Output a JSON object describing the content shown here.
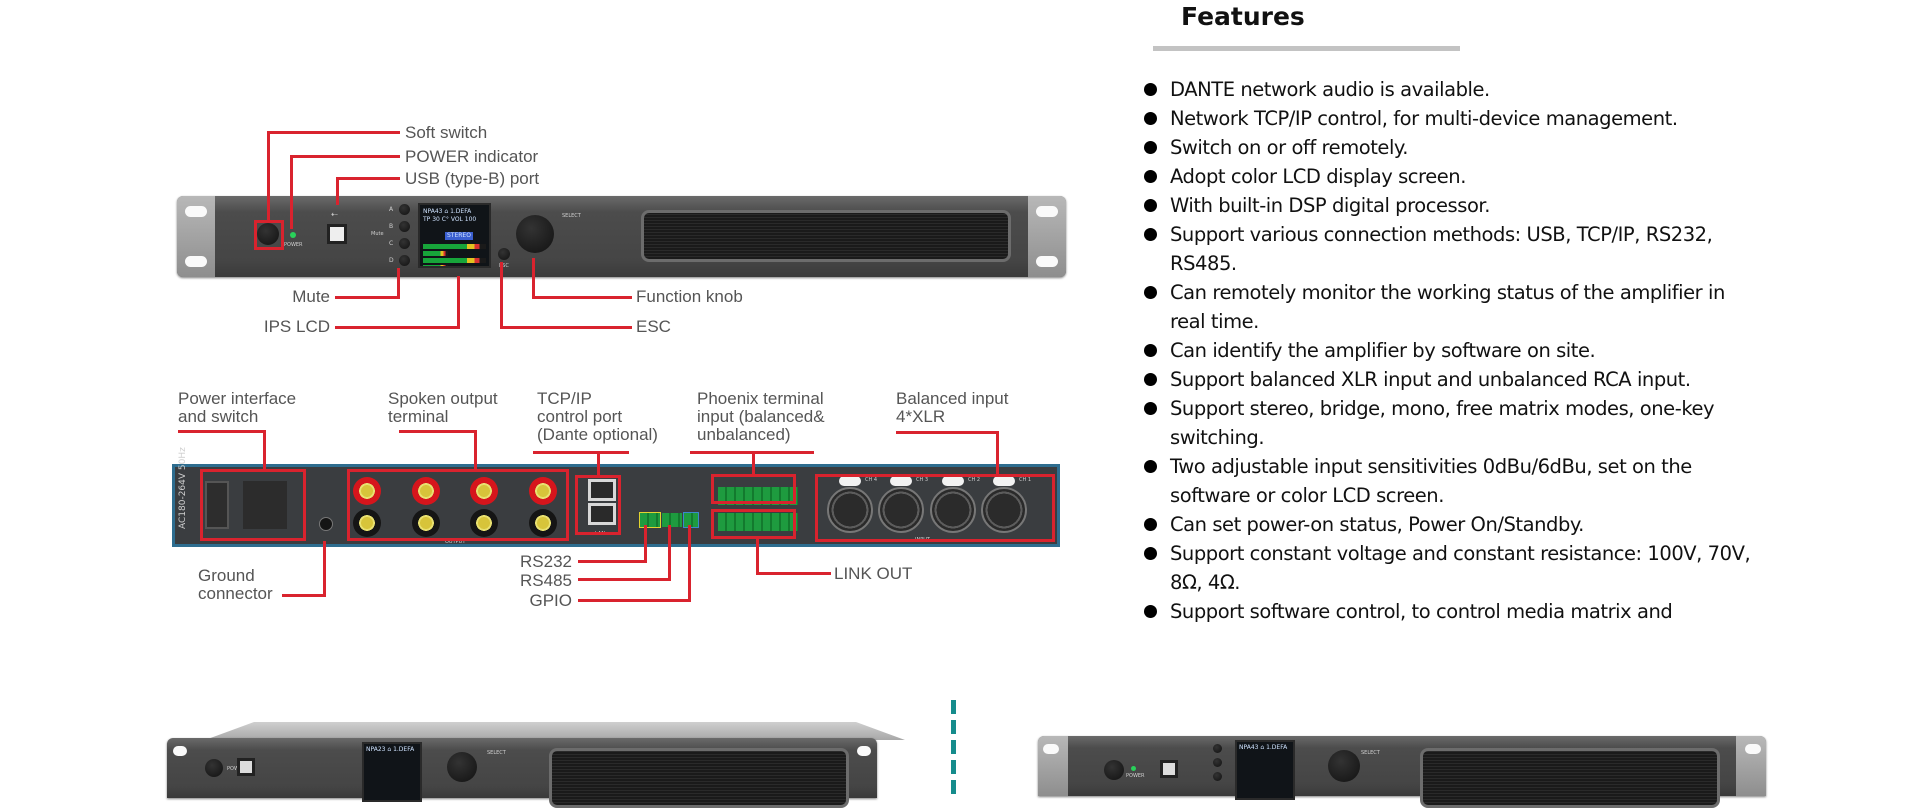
{
  "features": {
    "title": "Features",
    "items": [
      {
        "lines": [
          "DANTE network audio is available."
        ]
      },
      {
        "lines": [
          "Network TCP/IP control, for multi-device management."
        ]
      },
      {
        "lines": [
          "Switch on or off remotely."
        ]
      },
      {
        "lines": [
          "Adopt color LCD display screen."
        ]
      },
      {
        "lines": [
          "With built-in DSP digital processor."
        ]
      },
      {
        "lines": [
          "Support various connection methods: USB, TCP/IP, RS232,",
          "RS485."
        ]
      },
      {
        "lines": [
          "Can remotely monitor the working status of the amplifier in",
          "real time."
        ]
      },
      {
        "lines": [
          "Can identify the amplifier by software on site."
        ]
      },
      {
        "lines": [
          "Support balanced XLR input and unbalanced RCA input."
        ]
      },
      {
        "lines": [
          "Support stereo, bridge, mono, free matrix modes, one-key",
          "switching."
        ]
      },
      {
        "lines": [
          "Two adjustable input sensitivities 0dBu/6dBu, set on the",
          "software or color LCD screen."
        ]
      },
      {
        "lines": [
          "Can set power-on status, Power On/Standby."
        ]
      },
      {
        "lines": [
          "Support constant voltage and constant resistance: 100V, 70V,",
          "8Ω, 4Ω."
        ]
      },
      {
        "lines": [
          "Support software control, to control media matrix and"
        ]
      }
    ]
  },
  "front_panel": {
    "callouts": {
      "soft_switch": "Soft switch",
      "power_indicator": "POWER indicator",
      "usb_port": "USB (type-B) port",
      "mute": "Mute",
      "ips_lcd": "IPS LCD",
      "function_knob": "Function knob",
      "esc": "ESC"
    },
    "printed": {
      "power": "POWER",
      "mute": "Mute",
      "select": "SELECT",
      "esc": "ESC",
      "buttons": [
        "A",
        "B",
        "C",
        "D"
      ]
    },
    "lcd": {
      "line1": "NPA43 ⌂ 1.DEFA",
      "line2": "TP  30 C°  VOL  100",
      "mode": "STEREO"
    }
  },
  "rear_panel": {
    "callouts": {
      "power_interface": [
        "Power interface",
        "and switch"
      ],
      "speaker_output": [
        "Spoken output",
        "terminal"
      ],
      "tcpip": [
        "TCP/IP",
        "control port",
        "(Dante optional)"
      ],
      "phoenix": [
        "Phoenix terminal",
        "input (balanced&",
        "unbalanced)"
      ],
      "balanced_input": [
        "Balanced input",
        "4*XLR"
      ],
      "ground": [
        "Ground",
        "connector"
      ],
      "rs232": "RS232",
      "rs485": "RS485",
      "gpio": "GPIO",
      "link_out": "LINK OUT"
    },
    "printed": {
      "voltage": "AC180-264V",
      "freq": "50Hz",
      "output": "OUTPUT",
      "input": "INPUT",
      "lan": "LAN",
      "push": "PUSH",
      "xlr_channels": [
        "CH 4",
        "CH 3",
        "CH 2",
        "CH 1"
      ]
    }
  },
  "bottom_previews": {
    "left_lcd": "NPA23 ⌂ 1.DEFA",
    "right_lcd": "NPA43 ⌂ 1.DEFA",
    "select": "SELECT",
    "power": "POWER"
  }
}
